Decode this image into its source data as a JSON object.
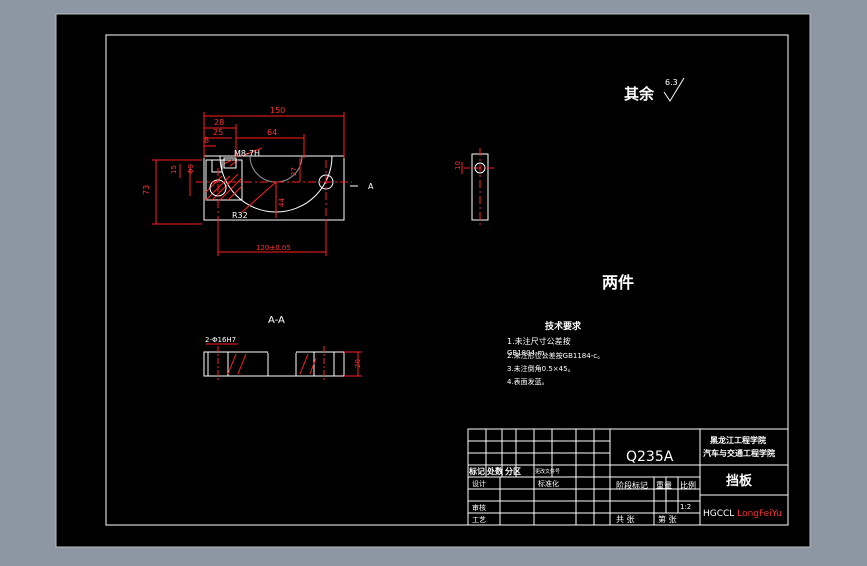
{
  "drawing": {
    "roughness_prefix": "其余",
    "roughness_value": "6.3",
    "quantity_note": "两件",
    "section_label": "A-A",
    "section_marker": "A"
  },
  "dimensions": {
    "d150": "150",
    "d28": "28",
    "d25": "25",
    "d8": "8",
    "d64": "64",
    "thread": "M8-7H",
    "d15": "15",
    "d9": "Φ9",
    "d27": "27",
    "d73": "73",
    "d44": "44",
    "r32": "R32",
    "d120": "120±0.05",
    "side_10": "10",
    "holes": "2-Φ16H7",
    "thk20": "20"
  },
  "tech_req": {
    "title": "技术要求",
    "lines": [
      "1.未注尺寸公差按",
      "GB1804-m。",
      "2.未注形位公差按GB1184-c。",
      "3.未注倒角0.5×45。",
      "4.表面发蓝。"
    ]
  },
  "title_block": {
    "material": "Q235A",
    "school_line1": "黑龙江工程学院",
    "school_line2": "汽车与交通工程学院",
    "part_name": "挡板",
    "h_mark": "标记",
    "h_count": "处数",
    "h_zone": "分区",
    "h_doc": "更改文件号",
    "h_design": "设计",
    "h_std": "标准化",
    "h_review": "审核",
    "h_process": "工艺",
    "h_stage": "阶段标记",
    "h_weight": "重量",
    "h_ratio": "比例",
    "ratio": "1:2",
    "sheets_total": "共 张",
    "sheet_no": "第 张",
    "code_prefix": "HGCCL",
    "code_author": "LongFeiYu"
  },
  "colors": {
    "background": "#8d97a3",
    "sheet": "#000000",
    "line": "#ffffff",
    "dimension": "#ff2020",
    "author": "#ff3030"
  }
}
